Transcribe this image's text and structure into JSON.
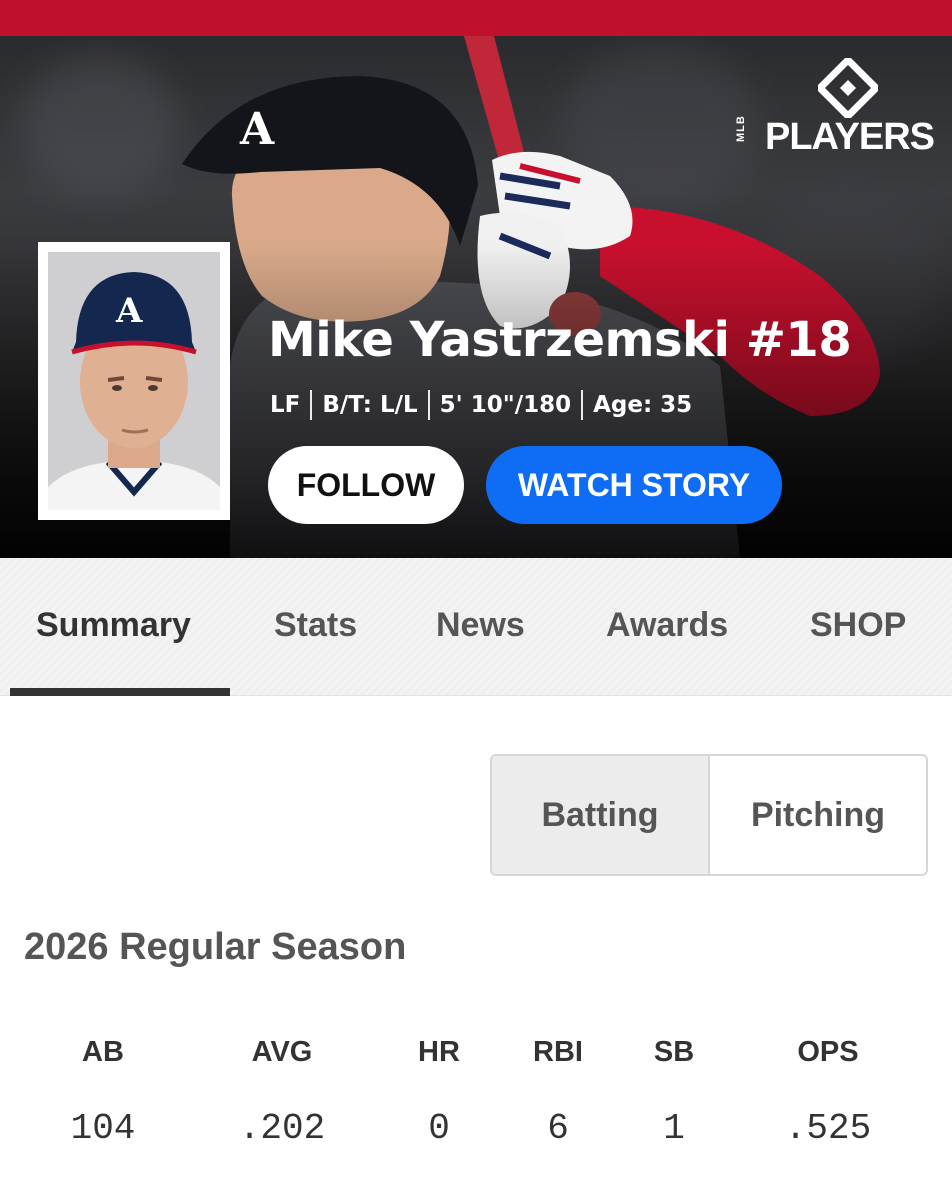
{
  "player": {
    "name": "Mike Yastrzemski #18",
    "position": "LF",
    "bats_throws": "B/T: L/L",
    "height_weight": "5' 10\"/180",
    "age": "Age: 35"
  },
  "brand": {
    "logo_text": "PLAYERS",
    "logo_small": "MLB"
  },
  "actions": {
    "follow_label": "FOLLOW",
    "watch_label": "WATCH STORY"
  },
  "tabs": [
    {
      "label": "Summary",
      "active": true
    },
    {
      "label": "Stats"
    },
    {
      "label": "News"
    },
    {
      "label": "Awards"
    },
    {
      "label": "SHOP"
    }
  ],
  "stat_type": {
    "options": [
      "Batting",
      "Pitching"
    ],
    "selected": "Batting"
  },
  "season": {
    "title": "2026 Regular Season",
    "headers": [
      "AB",
      "AVG",
      "HR",
      "RBI",
      "SB",
      "OPS"
    ],
    "values": [
      "104",
      ".202",
      "0",
      "6",
      "1",
      ".525"
    ]
  },
  "colors": {
    "topbar": "#c0102e",
    "watch_button": "#0f6df5",
    "cap_navy": "#13274f",
    "sleeve_red": "#c8102e"
  },
  "icons": [
    "mlb-players-logo-icon"
  ]
}
